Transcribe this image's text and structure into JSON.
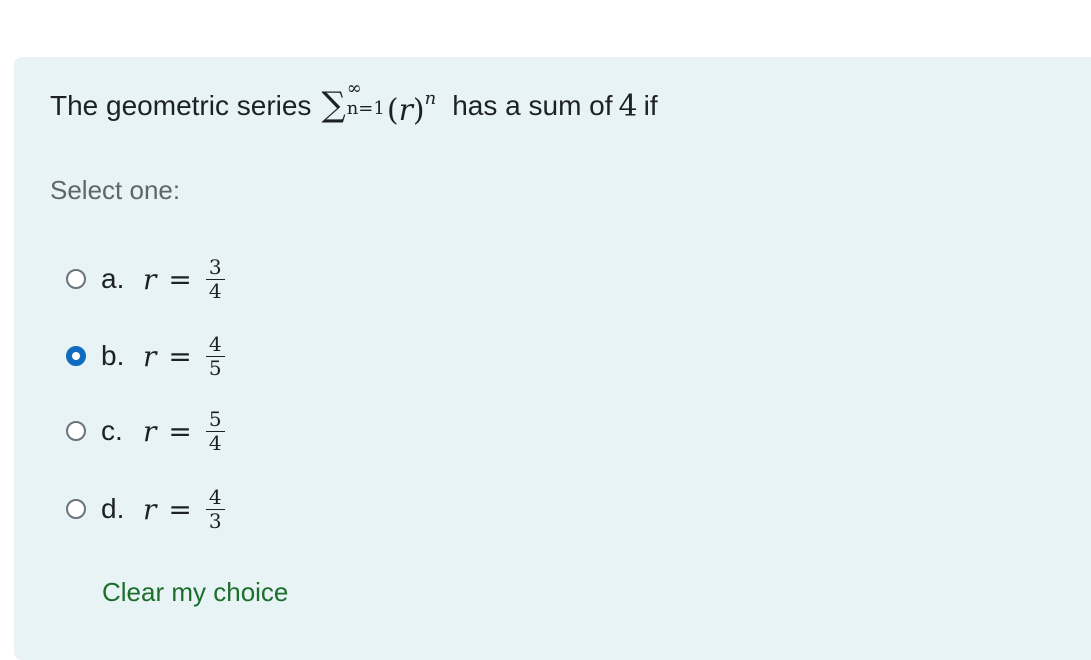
{
  "question": {
    "text_before": "The geometric series",
    "sum_symbol": "∑",
    "sum_upper": "∞",
    "sum_lower": "n=1",
    "term_open": "(",
    "term_var": "r",
    "term_close": ")",
    "term_exponent": "n",
    "text_middle": "has a sum of",
    "sum_value": "4",
    "text_after": "if"
  },
  "prompt": "Select one:",
  "answers": [
    {
      "letter": "a.",
      "variable": "r",
      "equals": "=",
      "numerator": "3",
      "denominator": "4",
      "selected": false
    },
    {
      "letter": "b.",
      "variable": "r",
      "equals": "=",
      "numerator": "4",
      "denominator": "5",
      "selected": true
    },
    {
      "letter": "c.",
      "variable": "r",
      "equals": "=",
      "numerator": "5",
      "denominator": "4",
      "selected": false
    },
    {
      "letter": "d.",
      "variable": "r",
      "equals": "=",
      "numerator": "4",
      "denominator": "3",
      "selected": false
    }
  ],
  "clear_label": "Clear my choice",
  "colors": {
    "card_background": "#e7f3f5",
    "radio_selected": "#0f6cbf",
    "link": "#1c6e2c",
    "prompt_text": "#5f656b"
  }
}
